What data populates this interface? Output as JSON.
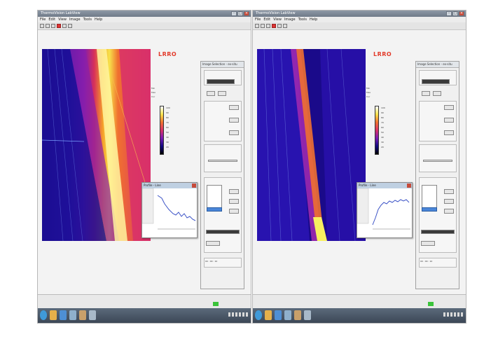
{
  "screens": [
    {
      "id": "left",
      "window_title": "ThermoVision LabView",
      "menu": [
        "File",
        "Edit",
        "View",
        "Image",
        "Tools",
        "Help"
      ],
      "logo": "LRRO",
      "info_lines": [
        "Min",
        "Max",
        "Cur"
      ],
      "colorbar_ticks": [
        "100",
        "90",
        "80",
        "70",
        "60",
        "50",
        "40",
        "30",
        "20"
      ],
      "panel_title": "Image Selection - ex-situ",
      "graph_title": "Profile - Line",
      "status": "00 : 00 : 10",
      "colors": {
        "hot": "#f7e24a",
        "bg_cold": "#1a0a8a",
        "mid": "#d8306a"
      }
    },
    {
      "id": "right",
      "window_title": "ThermoVision LabView",
      "menu": [
        "File",
        "Edit",
        "View",
        "Image",
        "Tools",
        "Help"
      ],
      "logo": "LRRO",
      "info_lines": [
        "Min",
        "Max",
        "Cur"
      ],
      "colorbar_ticks": [
        "100",
        "90",
        "80",
        "70",
        "60",
        "50",
        "40",
        "30",
        "20"
      ],
      "panel_title": "Image Selection - ex-situ",
      "graph_title": "Profile - Line",
      "status": "00 : 00 : 10",
      "colors": {
        "hot": "#f7e24a",
        "bg_cold": "#1a0a8a",
        "mid": "#8c2ab8"
      }
    }
  ],
  "icons": [
    "window-min-icon",
    "window-max-icon",
    "window-close-icon",
    "start-orb-icon",
    "folder-icon",
    "browser-icon"
  ]
}
